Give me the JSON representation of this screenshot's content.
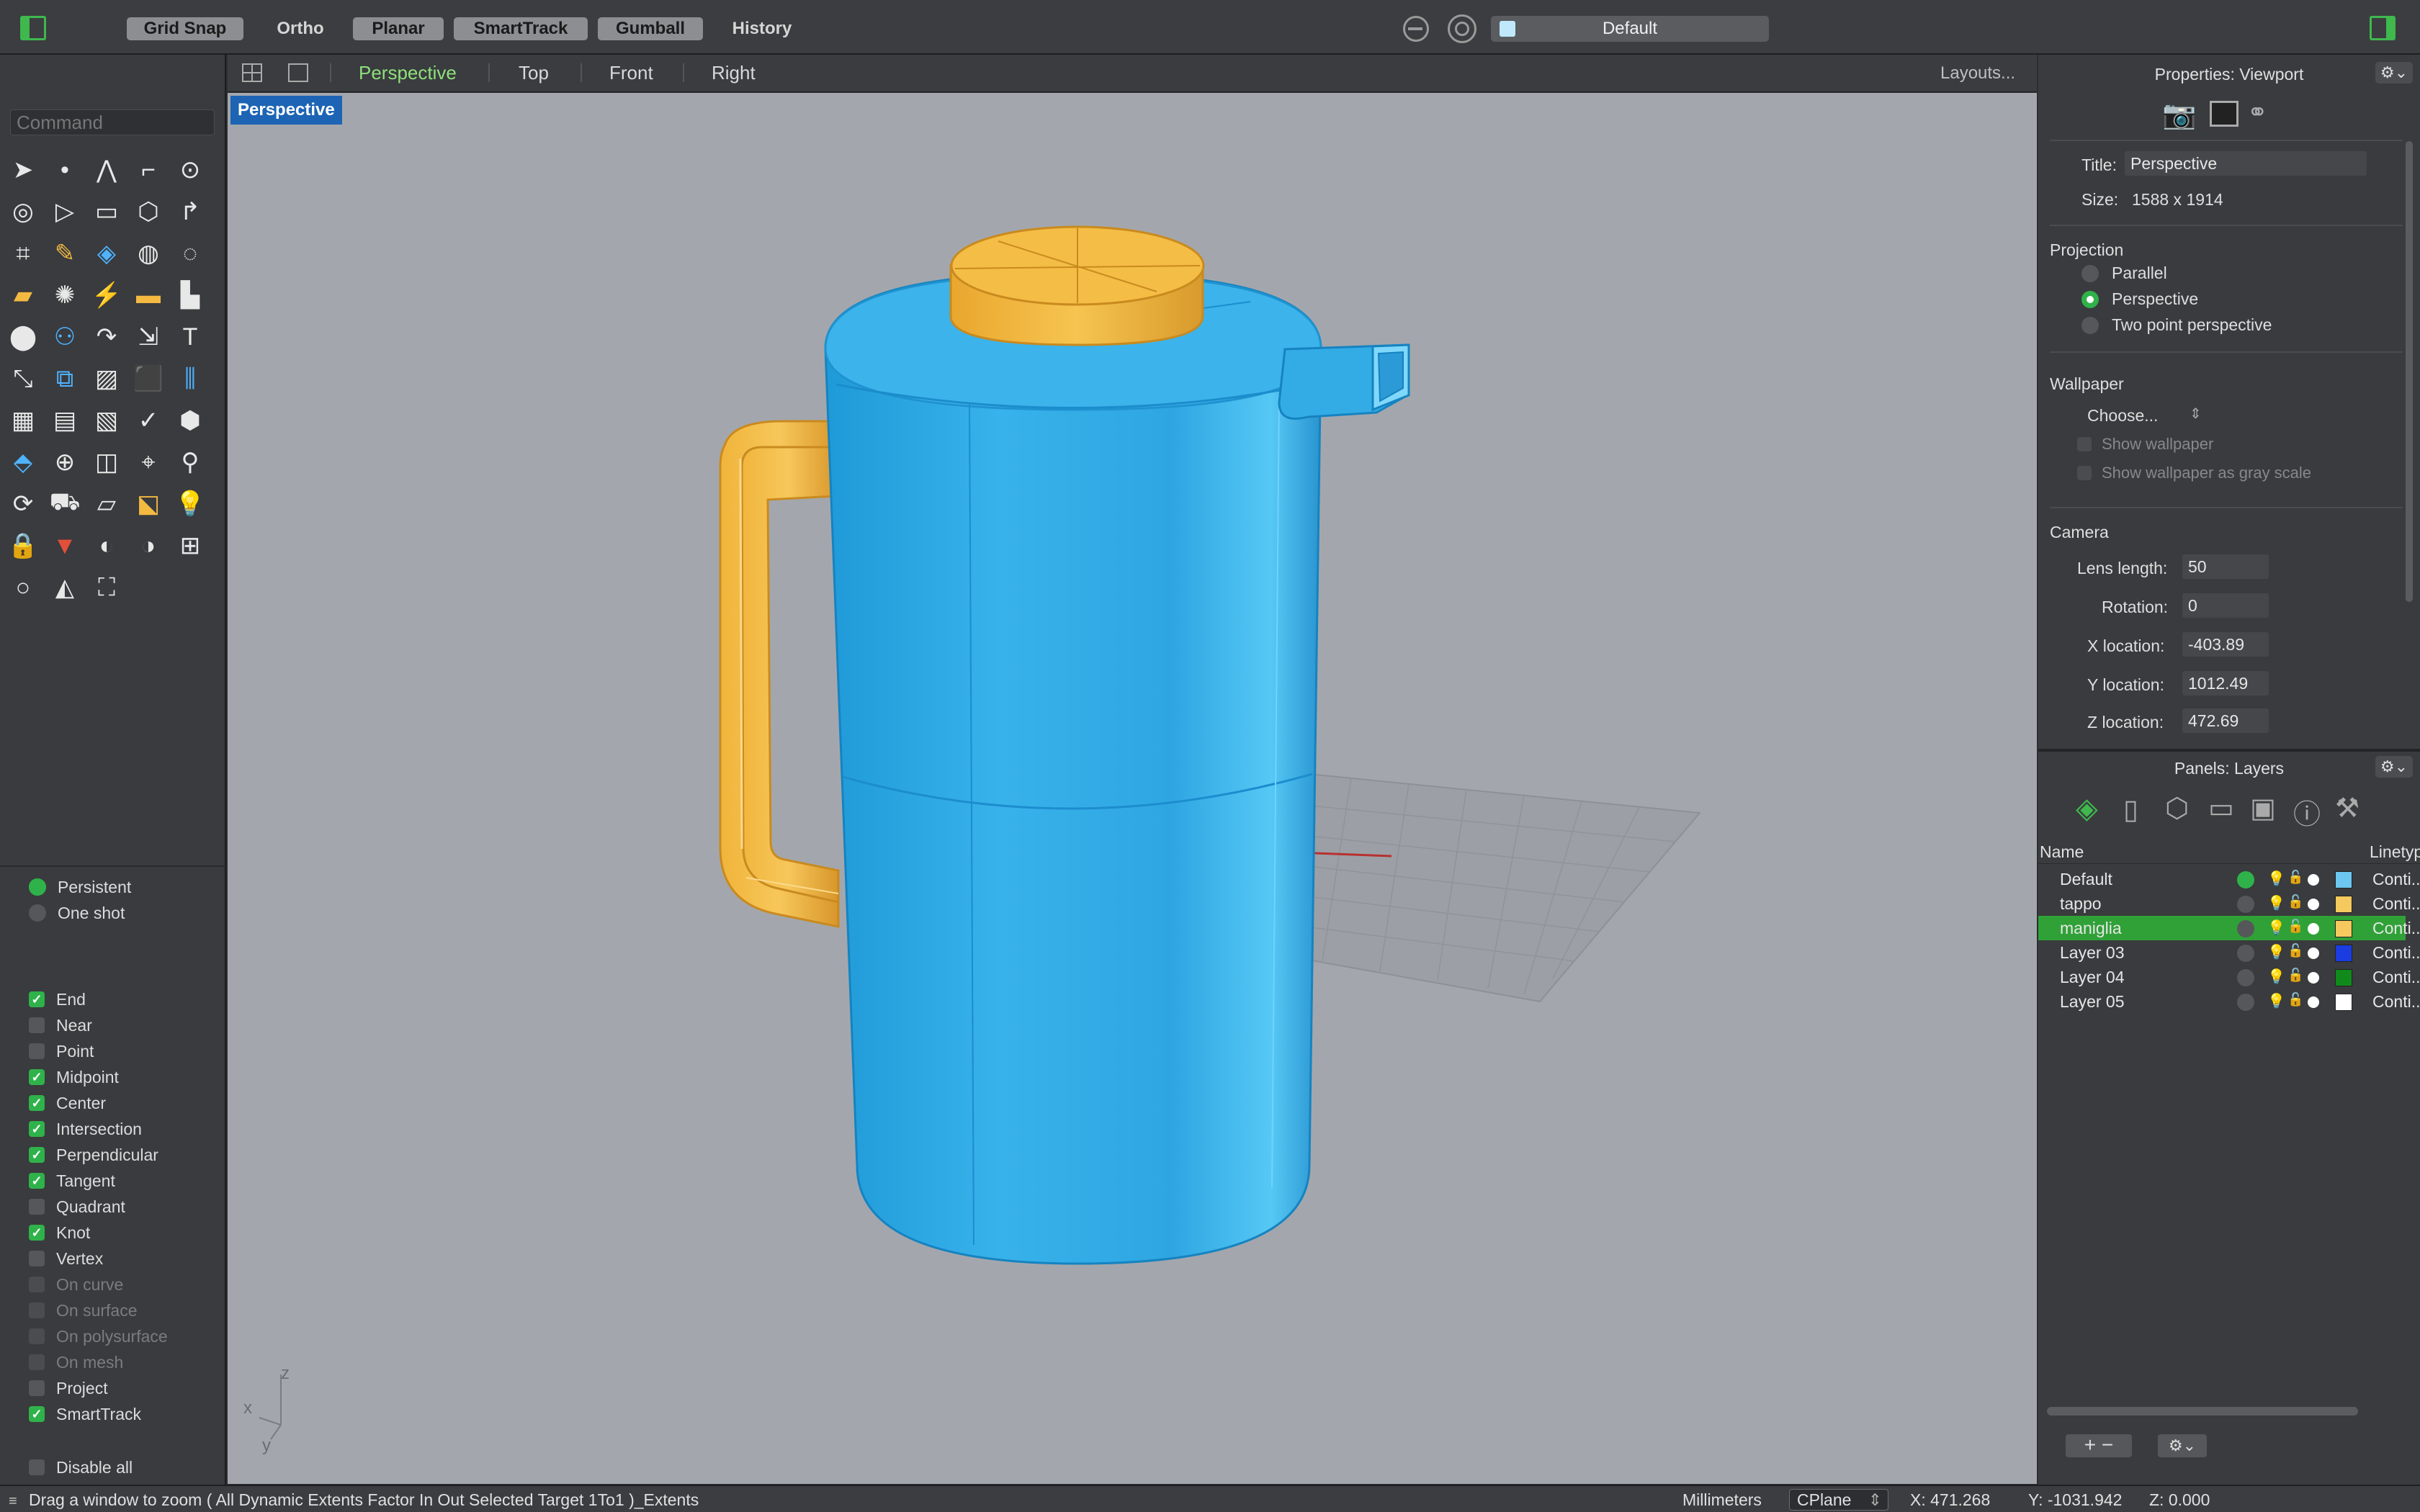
{
  "toolbar": {
    "buttons": [
      {
        "label": "Grid Snap",
        "active": true
      },
      {
        "label": "Ortho",
        "active": false
      },
      {
        "label": "Planar",
        "active": true
      },
      {
        "label": "SmartTrack",
        "active": true
      },
      {
        "label": "Gumball",
        "active": true
      },
      {
        "label": "History",
        "active": false
      }
    ],
    "layer_selector": "Default"
  },
  "view_tabs": {
    "tabs": [
      "Perspective",
      "Top",
      "Front",
      "Right"
    ],
    "active": "Perspective",
    "layouts_label": "Layouts..."
  },
  "command": {
    "placeholder": "Command"
  },
  "viewport": {
    "label": "Perspective",
    "axis_x": "x",
    "axis_y": "y",
    "axis_z": "z"
  },
  "osnap": {
    "modes": [
      {
        "label": "Persistent",
        "selected": true
      },
      {
        "label": "One shot",
        "selected": false
      }
    ],
    "items": [
      {
        "label": "End",
        "checked": true,
        "enabled": true
      },
      {
        "label": "Near",
        "checked": false,
        "enabled": true
      },
      {
        "label": "Point",
        "checked": false,
        "enabled": true
      },
      {
        "label": "Midpoint",
        "checked": true,
        "enabled": true
      },
      {
        "label": "Center",
        "checked": true,
        "enabled": true
      },
      {
        "label": "Intersection",
        "checked": true,
        "enabled": true
      },
      {
        "label": "Perpendicular",
        "checked": true,
        "enabled": true
      },
      {
        "label": "Tangent",
        "checked": true,
        "enabled": true
      },
      {
        "label": "Quadrant",
        "checked": false,
        "enabled": true
      },
      {
        "label": "Knot",
        "checked": true,
        "enabled": true
      },
      {
        "label": "Vertex",
        "checked": false,
        "enabled": true
      },
      {
        "label": "On curve",
        "checked": false,
        "enabled": false
      },
      {
        "label": "On surface",
        "checked": false,
        "enabled": false
      },
      {
        "label": "On polysurface",
        "checked": false,
        "enabled": false
      },
      {
        "label": "On mesh",
        "checked": false,
        "enabled": false
      },
      {
        "label": "Project",
        "checked": false,
        "enabled": true
      },
      {
        "label": "SmartTrack",
        "checked": true,
        "enabled": true
      }
    ],
    "disable_all": "Disable all"
  },
  "properties": {
    "header": "Properties: Viewport",
    "title_label": "Title:",
    "title_value": "Perspective",
    "size_label": "Size:",
    "size_value": "1588 x 1914",
    "projection_label": "Projection",
    "projection_options": [
      {
        "label": "Parallel",
        "selected": false
      },
      {
        "label": "Perspective",
        "selected": true
      },
      {
        "label": "Two point perspective",
        "selected": false
      }
    ],
    "wallpaper_label": "Wallpaper",
    "wallpaper_choose": "Choose...",
    "show_wallpaper": "Show wallpaper",
    "show_wallpaper_gray": "Show wallpaper as gray scale",
    "camera_label": "Camera",
    "camera_fields": [
      {
        "label": "Lens length:",
        "value": "50"
      },
      {
        "label": "Rotation:",
        "value": "0"
      },
      {
        "label": "X location:",
        "value": "-403.89"
      },
      {
        "label": "Y location:",
        "value": "1012.49"
      },
      {
        "label": "Z location:",
        "value": "472.69"
      }
    ]
  },
  "layers": {
    "header": "Panels: Layers",
    "col_name": "Name",
    "col_linetype": "Linetyp",
    "rows": [
      {
        "name": "Default",
        "color": "#6cc8f0",
        "linetype": "Conti...",
        "current": true,
        "selected": false
      },
      {
        "name": "tappo",
        "color": "#f5c95e",
        "linetype": "Conti...",
        "current": false,
        "selected": false
      },
      {
        "name": "maniglia",
        "color": "#f5c95e",
        "linetype": "Conti...",
        "current": false,
        "selected": true
      },
      {
        "name": "Layer 03",
        "color": "#1a3ce0",
        "linetype": "Conti...",
        "current": false,
        "selected": false
      },
      {
        "name": "Layer 04",
        "color": "#118a1c",
        "linetype": "Conti...",
        "current": false,
        "selected": false
      },
      {
        "name": "Layer 05",
        "color": "#ffffff",
        "linetype": "Conti...",
        "current": false,
        "selected": false
      }
    ]
  },
  "status": {
    "prompt": "Drag a window to zoom ( All Dynamic Extents Factor In Out Selected Target 1To1 )_Extents",
    "units": "Millimeters",
    "cplane": "CPlane",
    "x": "X: 471.268",
    "y": "Y: -1031.942",
    "z": "Z: 0.000"
  },
  "colors": {
    "accent": "#2fb24a",
    "body_blue": "#2fa9e0",
    "handle_orange": "#f2b63c",
    "viewport_bg": "#a3a7ad"
  }
}
